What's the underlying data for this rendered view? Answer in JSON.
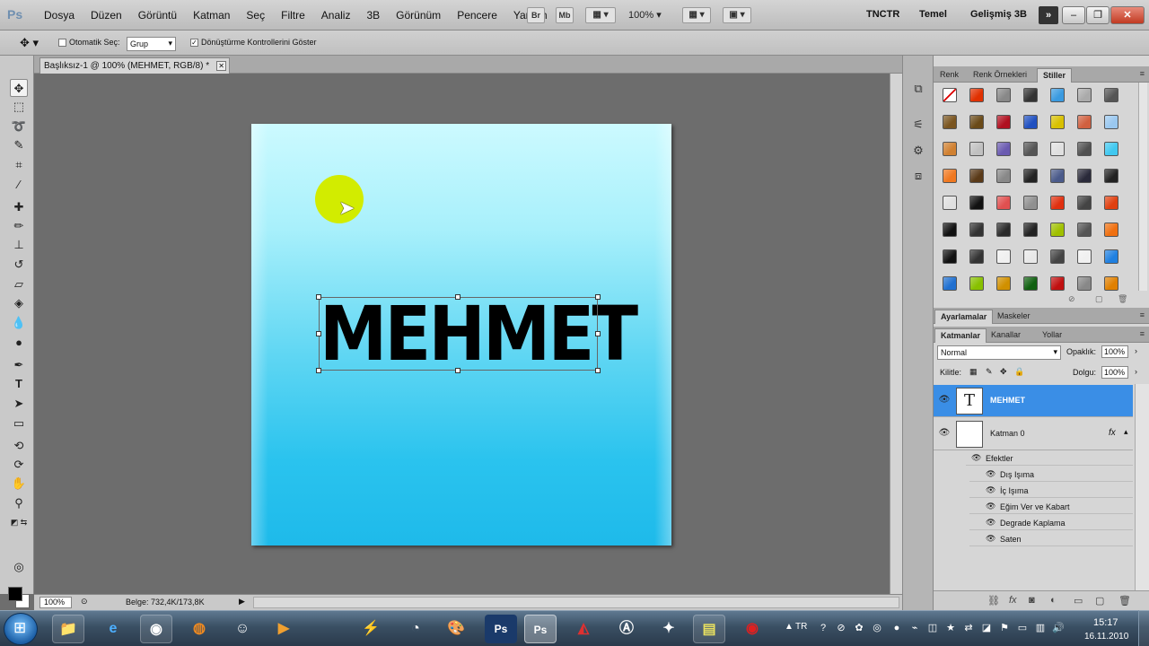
{
  "app": {
    "logo": "Ps"
  },
  "menu": [
    "Dosya",
    "Düzen",
    "Görüntü",
    "Katman",
    "Seç",
    "Filtre",
    "Analiz",
    "3B",
    "Görünüm",
    "Pencere",
    "Yardım"
  ],
  "menubar_buttons": {
    "bridge": "Br",
    "mini_bridge": "Mb",
    "zoom": "100%"
  },
  "workspaces": [
    "TNCTR",
    "Temel",
    "Gelişmiş 3B"
  ],
  "window_controls": {
    "minimize": "–",
    "restore": "❐",
    "close": "✕"
  },
  "options_bar": {
    "auto_select_label": "Otomatik Seç:",
    "auto_select_value": "Grup",
    "show_transform_label": "Dönüştürme Kontrollerini Göster"
  },
  "document": {
    "tab_title": "Başlıksız-1 @ 100% (MEHMET, RGB/8) *",
    "text_layer_content": "MEHMET"
  },
  "status": {
    "zoom": "100%",
    "doc_info": "Belge: 732,4K/173,8K"
  },
  "panels": {
    "top_tabs": [
      "Renk",
      "Renk Örnekleri",
      "Stiller"
    ],
    "top_active": "Stiller",
    "mid_tabs": [
      "Ayarlamalar",
      "Maskeler"
    ],
    "layers_tabs": [
      "Katmanlar",
      "Kanallar",
      "Yollar"
    ],
    "blend_mode": "Normal",
    "opacity_label": "Opaklık:",
    "opacity_value": "100%",
    "lock_label": "Kilitle:",
    "fill_label": "Dolgu:",
    "fill_value": "100%",
    "layers": [
      {
        "name": "MEHMET",
        "thumb": "T",
        "selected": true
      },
      {
        "name": "Katman 0",
        "thumb": "",
        "selected": false,
        "fx": "fx"
      }
    ],
    "effects_label": "Efektler",
    "effects": [
      "Dış Işıma",
      "İç Işıma",
      "Eğim Ver ve Kabart",
      "Degrade Kaplama",
      "Saten"
    ]
  },
  "style_swatch_colors": [
    "#ffffff",
    "#e03000",
    "#888888",
    "#333333",
    "#3a9ae0",
    "#aaaaaa",
    "#555555",
    "#7a5520",
    "#6a4a18",
    "#b01020",
    "#2050c0",
    "#d8c000",
    "#d06040",
    "#9ac8f0",
    "#d08030",
    "#c0c0c0",
    "#6a5ab0",
    "#555555",
    "#e0e0e0",
    "#505050",
    "#40c8f0",
    "#f07820",
    "#5a3a18",
    "#888888",
    "#222222",
    "#4a5a8a",
    "#2a2a3a",
    "#222222",
    "#e0e0e0",
    "#111111",
    "#e05050",
    "#909090",
    "#e03010",
    "#444444",
    "#e04010",
    "#111111",
    "#333333",
    "#2a2a2a",
    "#222222",
    "#a0c000",
    "#555555",
    "#f07010",
    "#111111",
    "#333333",
    "#f0f0f0",
    "#e8e8e8",
    "#444444",
    "#f0f0f0",
    "#2080e0",
    "#2070d0",
    "#88c000",
    "#d09000",
    "#106010",
    "#c01010",
    "#888888",
    "#e08000"
  ],
  "taskbar": {
    "apps": [
      "Windows Explorer",
      "Internet Explorer",
      "Google Chrome",
      "Firefox",
      "Messenger",
      "Media Player",
      "Dreamweaver",
      "CCleaner",
      "Paint",
      "Photoshop",
      "Photoshop CS5",
      "Acrobat",
      "Avast",
      "Counter-Strike",
      "Sticky Notes",
      "Opera"
    ],
    "language": "TR",
    "time": "15:17",
    "date": "16.11.2010"
  }
}
